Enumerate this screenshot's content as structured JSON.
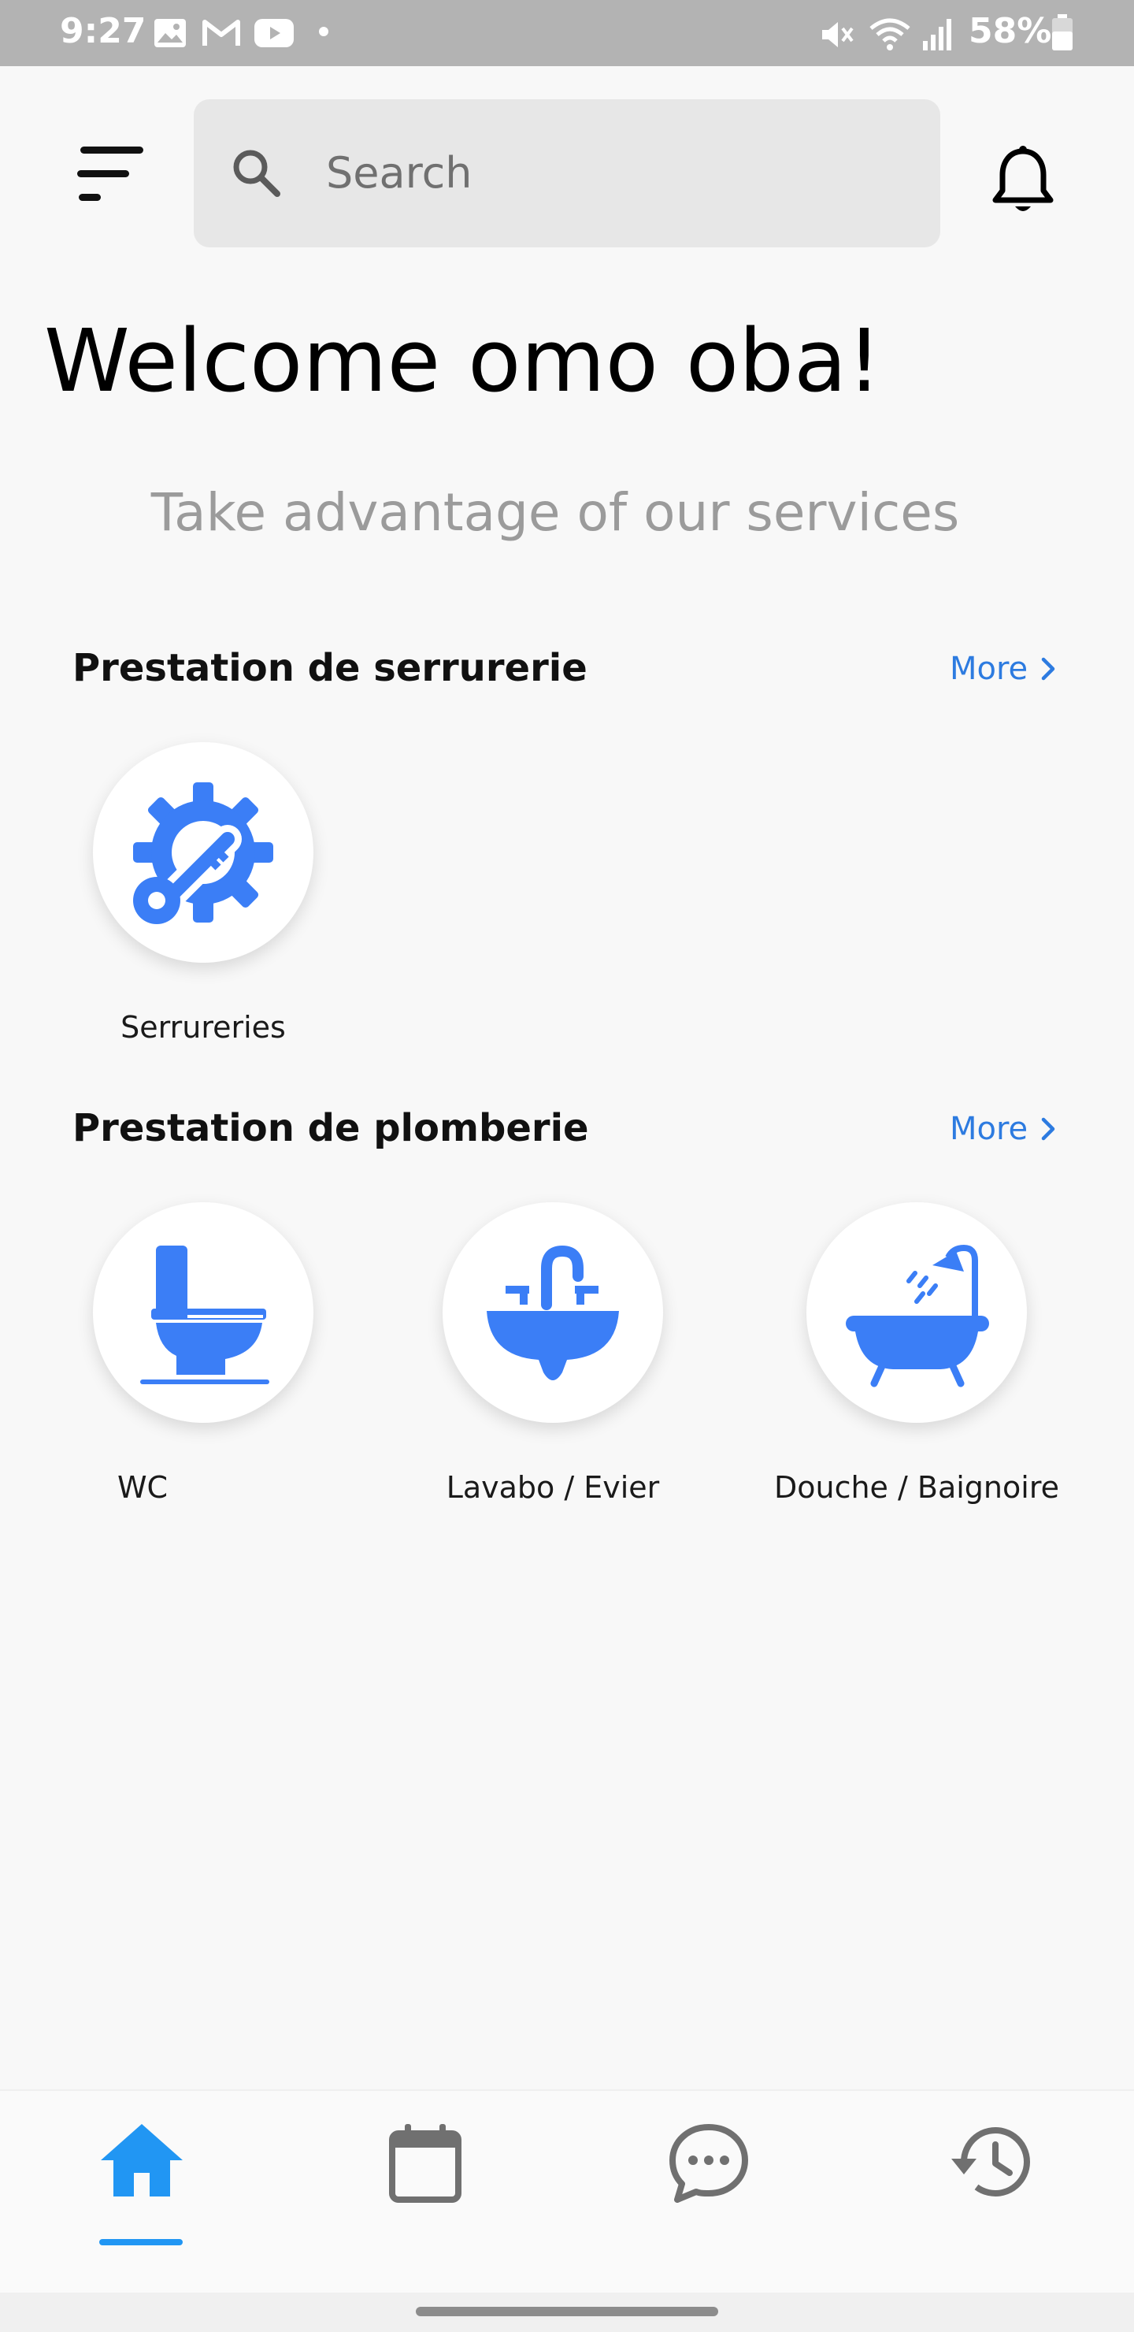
{
  "status_bar": {
    "time": "9:27",
    "battery": "58%",
    "icons": [
      "gallery-icon",
      "gmail-icon",
      "youtube-icon",
      "dot-icon",
      "mute-icon",
      "wifi-icon",
      "signal-icon",
      "battery-icon"
    ]
  },
  "header": {
    "search_placeholder": "Search",
    "menu_icon": "sort-menu-icon",
    "bell_icon": "bell-icon"
  },
  "welcome": "Welcome omo oba!",
  "subtitle": "Take advantage of our services",
  "sections": [
    {
      "title": "Prestation de serrurerie",
      "more": "More",
      "services": [
        {
          "label": "Serrureries",
          "icon": "key-gear-icon"
        }
      ]
    },
    {
      "title": "Prestation de plomberie",
      "more": "More",
      "services": [
        {
          "label": "WC",
          "icon": "toilet-icon"
        },
        {
          "label": "Lavabo / Evier",
          "icon": "sink-icon"
        },
        {
          "label": "Douche / Baignoire",
          "icon": "bathtub-icon"
        }
      ]
    }
  ],
  "bottom_nav": [
    {
      "icon": "home-icon",
      "active": true
    },
    {
      "icon": "calendar-icon",
      "active": false
    },
    {
      "icon": "chat-icon",
      "active": false
    },
    {
      "icon": "history-icon",
      "active": false
    }
  ],
  "colors": {
    "accent": "#3b7ef6",
    "link": "#2d7be0",
    "nav_active": "#2196f3",
    "nav_inactive": "#707070",
    "background": "#f8f8f8"
  }
}
